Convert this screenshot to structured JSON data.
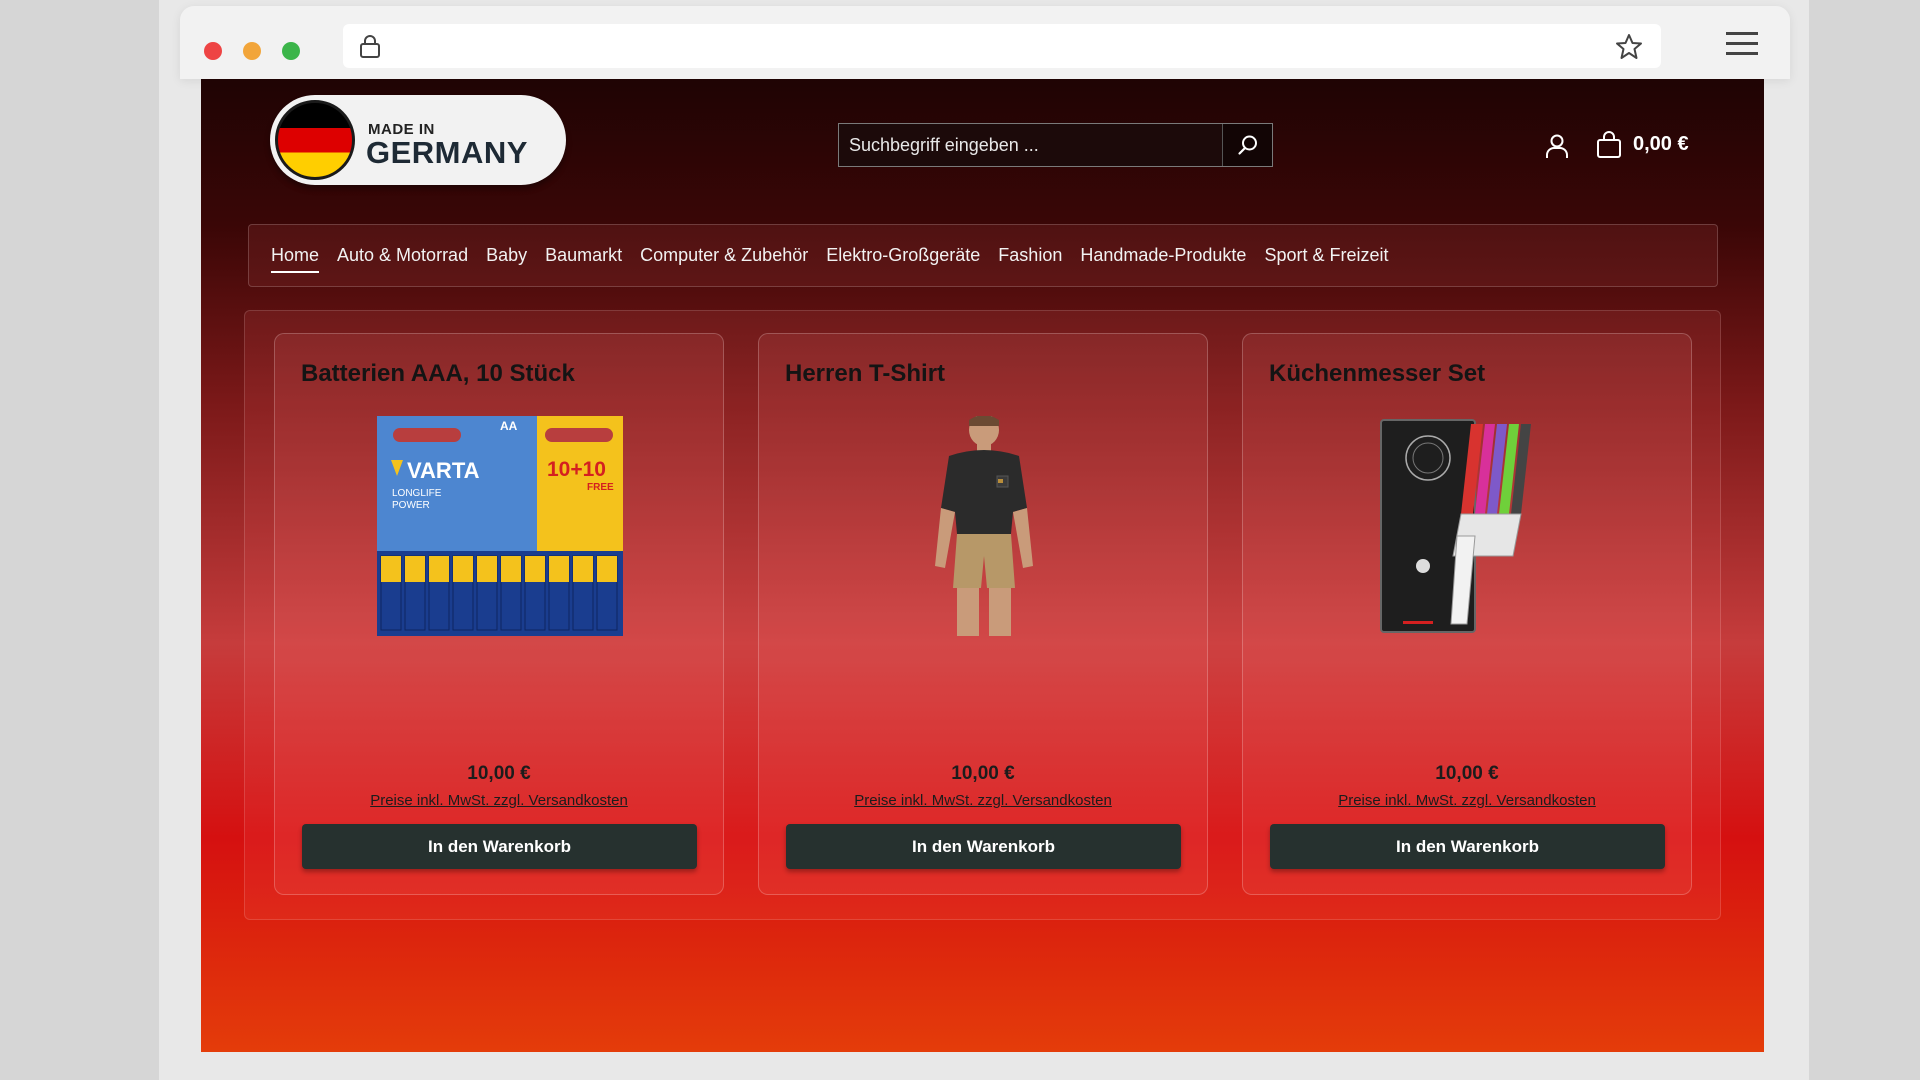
{
  "browser": {
    "icons": [
      "lock-icon",
      "star-icon",
      "menu-icon"
    ]
  },
  "header": {
    "logo": {
      "line1": "MADE IN",
      "line2": "GERMANY"
    },
    "search": {
      "placeholder": "Suchbegriff eingeben ...",
      "value": ""
    },
    "cart_total": "0,00 €"
  },
  "nav": {
    "items": [
      {
        "label": "Home",
        "active": true
      },
      {
        "label": "Auto & Motorrad"
      },
      {
        "label": "Baby"
      },
      {
        "label": "Baumarkt"
      },
      {
        "label": "Computer & Zubehör"
      },
      {
        "label": "Elektro-Großgeräte"
      },
      {
        "label": "Fashion"
      },
      {
        "label": "Handmade-Produkte"
      },
      {
        "label": "Sport & Freizeit"
      }
    ]
  },
  "products": [
    {
      "title": "Batterien AAA, 10 Stück",
      "price": "10,00 €",
      "shipping": "Preise inkl. MwSt. zzgl. Versandkosten",
      "button": "In den Warenkorb",
      "image": {
        "brand": "VARTA",
        "pack": "AA",
        "offer": "10+10",
        "offer_sub": "FREE",
        "line1": "LONGLIFE",
        "line2": "POWER"
      }
    },
    {
      "title": "Herren T-Shirt",
      "price": "10,00 €",
      "shipping": "Preise inkl. MwSt. zzgl. Versandkosten",
      "button": "In den Warenkorb"
    },
    {
      "title": "Küchenmesser Set",
      "price": "10,00 €",
      "shipping": "Preise inkl. MwSt. zzgl. Versandkosten",
      "button": "In den Warenkorb"
    }
  ]
}
